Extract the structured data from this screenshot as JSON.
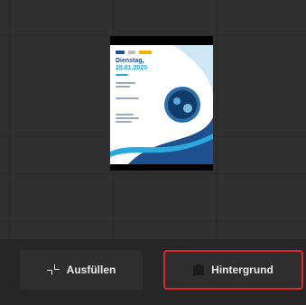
{
  "poster": {
    "date_line_1": "Dienstag,",
    "date_line_2": "28.01.2025"
  },
  "toolbar": {
    "fill_label": "Ausfüllen",
    "background_label": "Hintergrund"
  },
  "colors": {
    "highlight": "#d8272d",
    "poster_blue": "#1e4f8f",
    "poster_accent": "#2aa8dc"
  }
}
